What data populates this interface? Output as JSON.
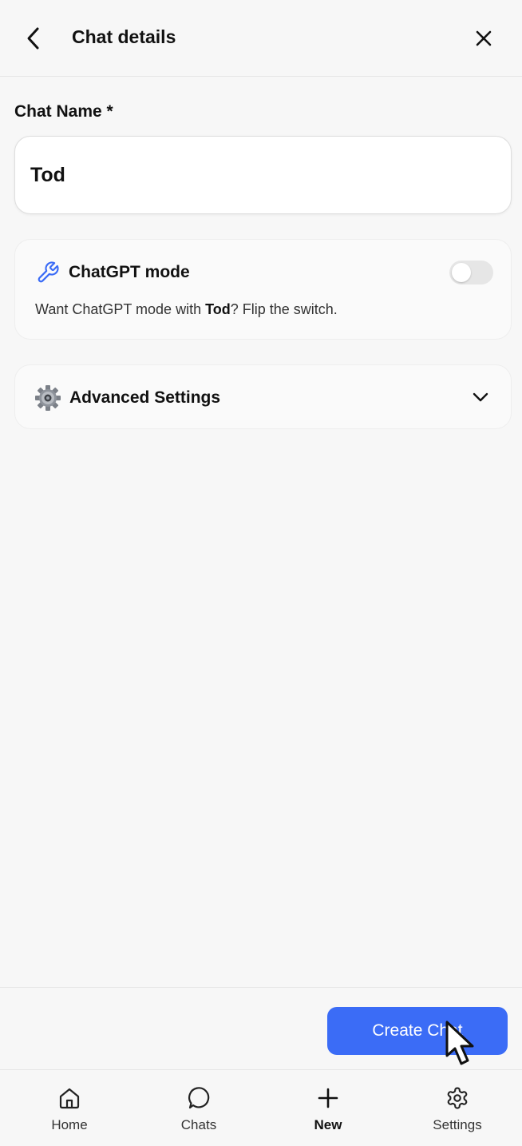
{
  "header": {
    "title": "Chat details",
    "back_icon": "chevron-left-icon",
    "close_icon": "close-icon"
  },
  "form": {
    "name_label": "Chat Name *",
    "name_value": "Tod"
  },
  "chatgpt_mode": {
    "title": "ChatGPT mode",
    "desc_prefix": "Want ChatGPT mode with ",
    "desc_name": "Tod",
    "desc_suffix": "? Flip the switch.",
    "enabled": false,
    "icon": "wrench-icon"
  },
  "advanced": {
    "title": "Advanced Settings",
    "icon": "gear-emoji-icon",
    "expanded": false
  },
  "actions": {
    "create_label": "Create Chat"
  },
  "nav": {
    "items": [
      {
        "label": "Home",
        "icon": "home-icon"
      },
      {
        "label": "Chats",
        "icon": "chat-bubble-icon"
      },
      {
        "label": "New",
        "icon": "plus-icon",
        "active": true
      },
      {
        "label": "Settings",
        "icon": "gear-icon"
      }
    ]
  },
  "colors": {
    "accent": "#3b6cf6",
    "background": "#f7f7f7",
    "card": "#fafafa",
    "toggle_off": "#e6e6e6"
  }
}
